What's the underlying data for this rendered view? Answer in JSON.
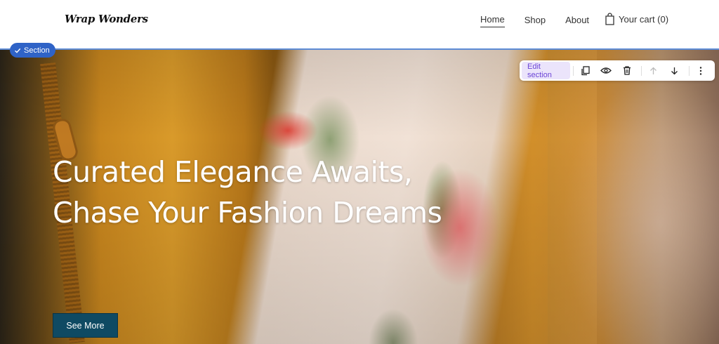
{
  "header": {
    "logo": "Wrap Wonders",
    "nav": [
      {
        "label": "Home",
        "active": true
      },
      {
        "label": "Shop",
        "active": false
      },
      {
        "label": "About",
        "active": false
      }
    ],
    "cart_label": "Your cart (0)"
  },
  "hero": {
    "title_line1": "Curated Elegance Awaits,",
    "title_line2": "Chase Your Fashion Dreams",
    "button_label": "See More"
  },
  "editor": {
    "section_badge": "Section",
    "edit_section_label": "Edit section",
    "toolbar_icons": [
      "duplicate-icon",
      "eye-icon",
      "trash-icon",
      "arrow-up-icon",
      "arrow-down-icon",
      "more-vertical-icon"
    ],
    "accent_color": "#2f63c7",
    "edit_color": "#6b45d6"
  },
  "colors": {
    "button_bg": "#0f4a63"
  }
}
